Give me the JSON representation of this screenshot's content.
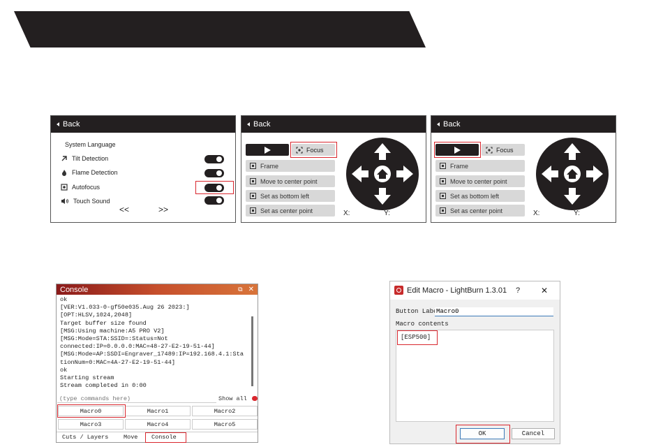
{
  "panel1": {
    "back_label": "Back",
    "heading": "System Language",
    "rows": [
      {
        "label": "Tilt Detection",
        "icon": "tilt-icon"
      },
      {
        "label": "Flame Detection",
        "icon": "flame-icon"
      },
      {
        "label": "Autofocus",
        "icon": "autofocus-icon"
      },
      {
        "label": "Touch Sound",
        "icon": "speaker-icon"
      }
    ],
    "prev_label": "<<",
    "next_label": ">>"
  },
  "panel2": {
    "back_label": "Back",
    "focus_label": "Focus",
    "buttons": [
      "Frame",
      "Move to center point",
      "Set as bottom left",
      "Set as center point"
    ],
    "x_label": "X:",
    "y_label": "Y:"
  },
  "panel3": {
    "back_label": "Back",
    "focus_label": "Focus",
    "buttons": [
      "Frame",
      "Move to center point",
      "Set as bottom left",
      "Set as center point"
    ],
    "x_label": "X:",
    "y_label": "Y:"
  },
  "console": {
    "title": "Console",
    "log": "ok\n[VER:V1.033-0-gf50e035.Aug 26 2023:]\n[OPT:HLSV,1024,2048]\nTarget buffer size found\n[MSG:Using machine:A5 PRO V2]\n[MSG:Mode=STA:SSID=:Status=Not\nconnected:IP=0.0.0.0:MAC=48-27-E2-19-51-44]\n[MSG:Mode=AP:SSDI=Engraver_17489:IP=192.168.4.1:Sta\ntionNum=0:MAC=4A-27-E2-19-51-44]\nok\nStarting stream\nStream completed in 0:00",
    "input_placeholder": "(type commands here)",
    "show_all_label": "Show all",
    "macros": [
      "Macro0",
      "Macro1",
      "Macro2",
      "Macro3",
      "Macro4",
      "Macro5"
    ],
    "tabs": [
      "Cuts / Layers",
      "Move",
      "Console"
    ]
  },
  "dialog": {
    "title": "Edit Macro - LightBurn 1.3.01",
    "help_label": "?",
    "close_label": "✕",
    "button_label_caption": "Button Label:",
    "button_label_value": "Macro0",
    "contents_caption": "Macro contents",
    "contents_value": "[ESP500]",
    "ok_label": "OK",
    "cancel_label": "Cancel"
  },
  "colors": {
    "highlight": "#d9272e",
    "dark": "#231f20",
    "button_grey": "#d8d8d8"
  }
}
